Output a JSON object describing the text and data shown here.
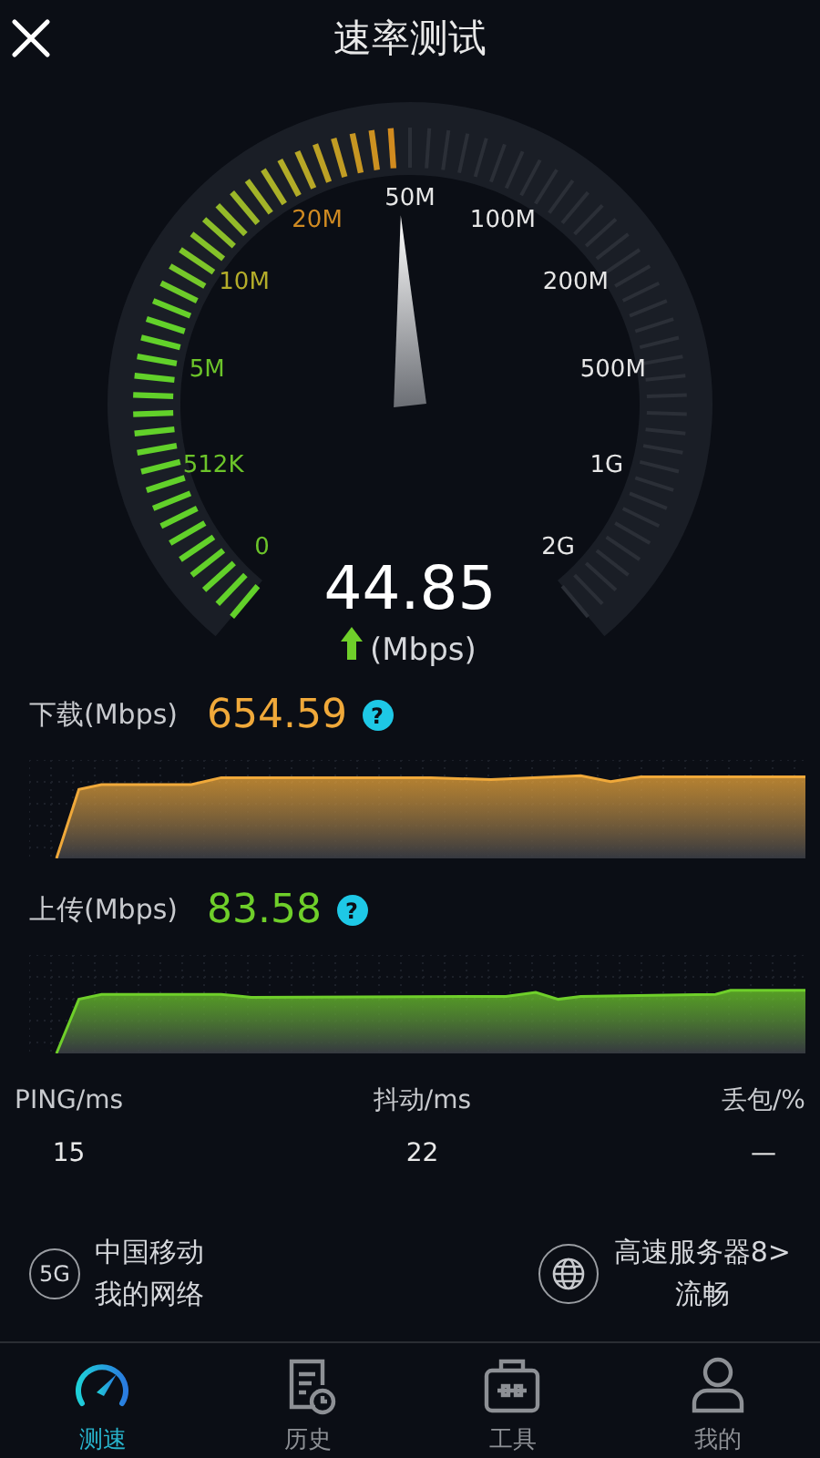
{
  "header": {
    "title": "速率测试"
  },
  "gauge": {
    "labels": [
      {
        "text": "0",
        "color": "#6cc42a"
      },
      {
        "text": "512K",
        "color": "#6cc42a"
      },
      {
        "text": "5M",
        "color": "#6cc42a"
      },
      {
        "text": "10M",
        "color": "#b3ac2a"
      },
      {
        "text": "20M",
        "color": "#cf8a22"
      },
      {
        "text": "50M",
        "color": "#e6e6e6"
      },
      {
        "text": "100M",
        "color": "#e6e6e6"
      },
      {
        "text": "200M",
        "color": "#e6e6e6"
      },
      {
        "text": "500M",
        "color": "#e6e6e6"
      },
      {
        "text": "1G",
        "color": "#e6e6e6"
      },
      {
        "text": "2G",
        "color": "#e6e6e6"
      }
    ],
    "reading": "44.85",
    "unit": "(Mbps)"
  },
  "results": [
    {
      "kind": "download",
      "label": "下载(Mbps)",
      "value": "654.59",
      "help": "?",
      "color": "#f0a93a"
    },
    {
      "kind": "upload",
      "label": "上传(Mbps)",
      "value": "83.58",
      "help": "?",
      "color": "#6fcf2a"
    }
  ],
  "stats": [
    {
      "label": "PING/ms",
      "value": "15"
    },
    {
      "label": "抖动/ms",
      "value": "22"
    },
    {
      "label": "丢包/%",
      "value": "—"
    }
  ],
  "network": {
    "badge": "5G",
    "lines": [
      "中国移动",
      "我的网络"
    ]
  },
  "server": {
    "lines": [
      "高速服务器8>",
      "流畅"
    ]
  },
  "tabs": [
    {
      "label": "测速",
      "kind": "gauge",
      "selected": true
    },
    {
      "label": "历史",
      "kind": "history",
      "selected": false
    },
    {
      "label": "工具",
      "kind": "toolbox",
      "selected": false
    },
    {
      "label": "我的",
      "kind": "person",
      "selected": false
    }
  ]
}
